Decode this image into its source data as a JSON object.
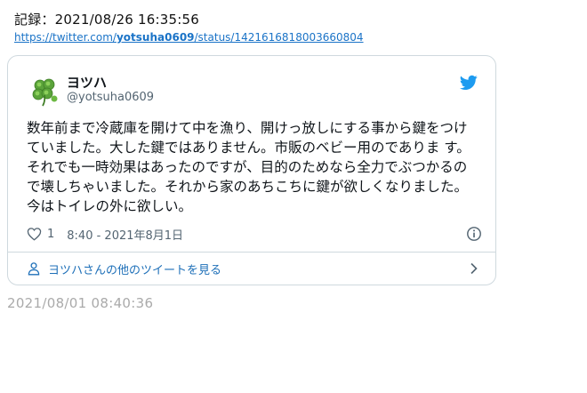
{
  "header": {
    "record_text": "記録：2021/08/26 16:35:56",
    "url_prefix": "https://twitter.com/",
    "url_user": "yotsuha0609",
    "url_suffix": "/status/1421616818003660804"
  },
  "tweet": {
    "display_name": "ヨツハ",
    "handle": "@yotsuha0609",
    "text": "数年前まで冷蔵庫を開けて中を漁り、開けっ放しにする事から鍵をつけていました。大した鍵ではありません。市販のベビー用のでありま す。それでも一時効果はあったのですが、目的のためなら全力でぶつかるので壊しちゃいました。それから家のあちこちに鍵が欲しくなりました。今はトイレの外に欲しい。",
    "likes": "1",
    "timestamp": "8:40 - 2021年8月1日",
    "more_tweets_label": "ヨツハさんの他のツイートを見る"
  },
  "footer": {
    "archived_at": "2021/08/01 08:40:36"
  },
  "icons": {
    "avatar": "clover-avatar",
    "bird": "twitter-bird-icon",
    "heart": "heart-icon",
    "info": "info-icon",
    "person": "person-icon",
    "chevron": "chevron-right-icon"
  },
  "colors": {
    "link": "#1a73c7",
    "twitter_blue": "#1d9bf0",
    "muted": "#536471",
    "border": "#cfd9de"
  }
}
